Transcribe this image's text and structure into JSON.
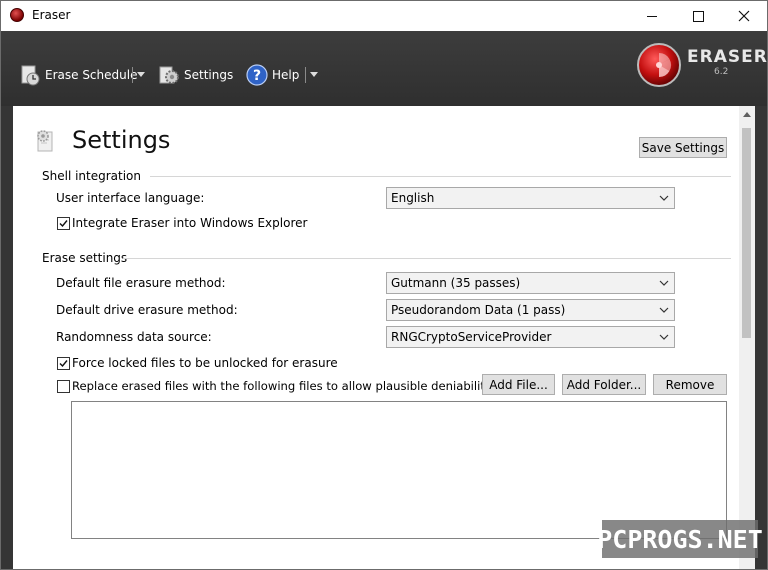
{
  "window": {
    "title": "Eraser",
    "minimize_icon": "minimize-icon",
    "maximize_icon": "maximize-icon",
    "close_icon": "close-icon"
  },
  "toolbar": {
    "erase_schedule": "Erase Schedule",
    "settings": "Settings",
    "help": "Help",
    "logo_text": "ERASER",
    "logo_version": "6.2"
  },
  "page": {
    "title": "Settings",
    "save_button": "Save Settings"
  },
  "shell_integration": {
    "heading": "Shell integration",
    "language_label": "User interface language:",
    "language_value": "English",
    "integrate_label": "Integrate Eraser into Windows Explorer",
    "integrate_checked": true
  },
  "erase_settings": {
    "heading": "Erase settings",
    "file_method_label": "Default file erasure method:",
    "file_method_value": "Gutmann (35 passes)",
    "drive_method_label": "Default drive erasure method:",
    "drive_method_value": "Pseudorandom Data (1 pass)",
    "random_source_label": "Randomness data source:",
    "random_source_value": "RNGCryptoServiceProvider",
    "force_unlock_label": "Force locked files to be unlocked for erasure",
    "force_unlock_checked": true,
    "plausible_label": "Replace erased files with the following files to allow plausible deniability",
    "plausible_checked": false,
    "add_file_button": "Add File...",
    "add_folder_button": "Add Folder...",
    "remove_button": "Remove"
  },
  "watermark": "PCPROGS.NET",
  "colors": {
    "toolbar_bg": "#353535",
    "accent_red": "#c41010",
    "panel_bg": "#ffffff"
  }
}
